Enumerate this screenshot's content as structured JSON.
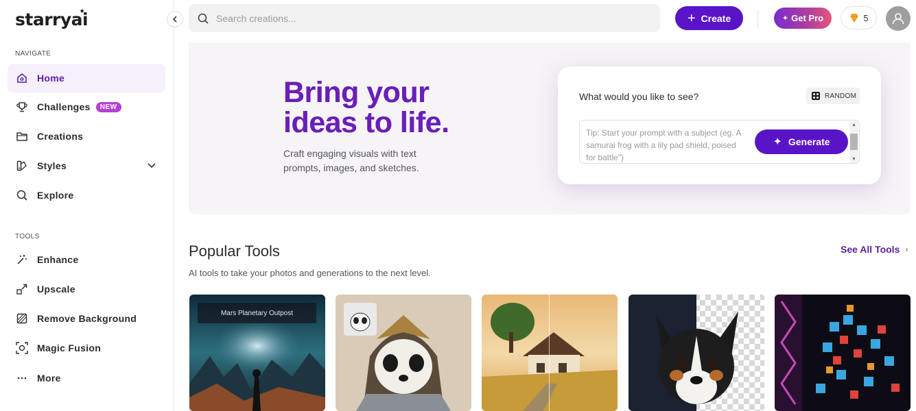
{
  "app": {
    "logo": "starryai"
  },
  "sidebar": {
    "navigate_label": "NAVIGATE",
    "nav": [
      {
        "label": "Home",
        "icon": "home-icon",
        "active": true
      },
      {
        "label": "Challenges",
        "icon": "trophy-icon",
        "badge": "NEW"
      },
      {
        "label": "Creations",
        "icon": "folder-icon"
      },
      {
        "label": "Styles",
        "icon": "styles-icon"
      },
      {
        "label": "Explore",
        "icon": "search-icon"
      }
    ],
    "tools_label": "TOOLS",
    "tools": [
      {
        "label": "Enhance",
        "icon": "magic-wand-icon"
      },
      {
        "label": "Upscale",
        "icon": "upscale-icon"
      },
      {
        "label": "Remove Background",
        "icon": "remove-background-icon"
      },
      {
        "label": "Magic Fusion",
        "icon": "magic-fusion-icon"
      },
      {
        "label": "More",
        "icon": "more-icon"
      }
    ]
  },
  "topbar": {
    "search_placeholder": "Search creations...",
    "create_label": "Create",
    "getpro_label": "Get Pro",
    "credits": "5"
  },
  "hero": {
    "title_line1": "Bring your",
    "title_line2": "ideas to life.",
    "subtitle": "Craft engaging visuals with text prompts, images, and sketches.",
    "prompt_question": "What would you like to see?",
    "random_label": "RANDOM",
    "prompt_placeholder": "Tip: Start your prompt with a subject (eg. A samurai frog with a lily pad shield, poised for battle\")",
    "generate_label": "Generate"
  },
  "popular_tools": {
    "title": "Popular Tools",
    "subtitle": "AI tools to take your photos and generations to the next level.",
    "see_all": "See All Tools",
    "cards": [
      {
        "label": "Mars Planetary Outpost"
      },
      {
        "label": ""
      },
      {
        "label": ""
      },
      {
        "label": ""
      },
      {
        "label": ""
      }
    ]
  },
  "colors": {
    "accent": "#5a14c8",
    "title": "#6a1fb8",
    "active_bg": "#f6f0fc",
    "badge": "#b63fd6"
  }
}
